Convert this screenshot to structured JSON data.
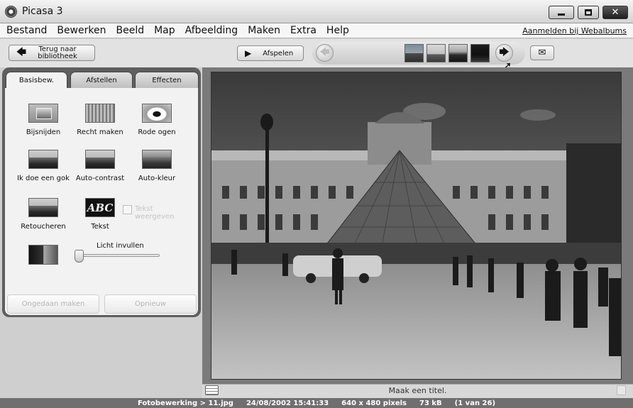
{
  "window": {
    "title": "Picasa 3"
  },
  "menu": {
    "items": [
      "Bestand",
      "Bewerken",
      "Beeld",
      "Map",
      "Afbeelding",
      "Maken",
      "Extra",
      "Help"
    ],
    "signin": "Aanmelden bij Webalbums"
  },
  "toolbar": {
    "back_label": "Terug naar bibliotheek",
    "play_label": "Afspelen"
  },
  "tabs": [
    "Basisbew.",
    "Afstellen",
    "Effecten"
  ],
  "tools": {
    "crop": "Bijsnijden",
    "straighten": "Recht maken",
    "redeye": "Rode ogen",
    "feeling_lucky": "Ik doe een gok",
    "auto_contrast": "Auto-contrast",
    "auto_color": "Auto-kleur",
    "retouch": "Retoucheren",
    "text": "Tekst",
    "text_icon": "ABC",
    "show_text": "Tekst weergeven",
    "fill_light": "Licht invullen",
    "fill_light_level": 0
  },
  "actions": {
    "undo": "Ongedaan maken",
    "redo": "Opnieuw"
  },
  "caption": {
    "placeholder": "Maak een titel."
  },
  "status": {
    "path": "Fotobewerking > 11.jpg",
    "datetime": "24/08/2002 15:41:33",
    "dimensions": "640 x 480 pixels",
    "size": "73 kB",
    "position": "(1 van 26)"
  }
}
